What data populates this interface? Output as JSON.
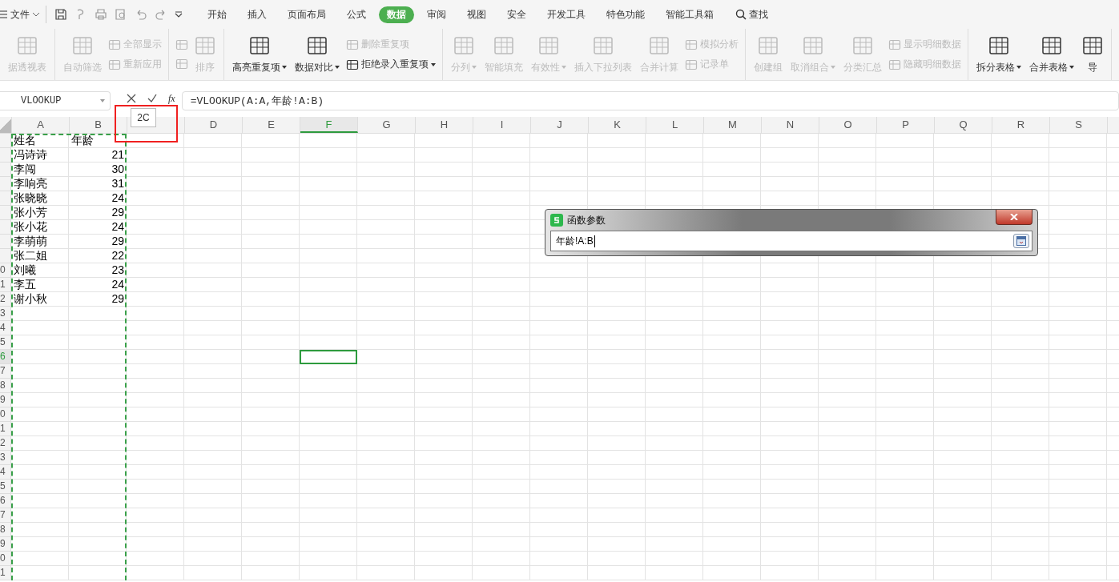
{
  "menu": {
    "label": "文件"
  },
  "tabs": [
    {
      "label": "开始",
      "selected": false
    },
    {
      "label": "插入",
      "selected": false
    },
    {
      "label": "页面布局",
      "selected": false
    },
    {
      "label": "公式",
      "selected": false
    },
    {
      "label": "数据",
      "selected": true
    },
    {
      "label": "审阅",
      "selected": false
    },
    {
      "label": "视图",
      "selected": false
    },
    {
      "label": "安全",
      "selected": false
    },
    {
      "label": "开发工具",
      "selected": false
    },
    {
      "label": "特色功能",
      "selected": false
    },
    {
      "label": "智能工具箱",
      "selected": false
    }
  ],
  "search": {
    "label": "查找"
  },
  "ribbon": {
    "groups": [
      {
        "items": [
          {
            "kind": "large",
            "label": "据透视表",
            "disabled": true,
            "dropdown": false
          }
        ]
      },
      {
        "items": [
          {
            "kind": "large",
            "label": "自动筛选",
            "disabled": true,
            "dropdown": false
          },
          {
            "kind": "stack",
            "children": [
              {
                "label": "全部显示",
                "disabled": true,
                "dropdown": false
              },
              {
                "label": "重新应用",
                "disabled": true,
                "dropdown": false
              }
            ]
          }
        ]
      },
      {
        "items": [
          {
            "kind": "stack",
            "children": [
              {
                "disabled": true,
                "dropdown": false
              },
              {
                "disabled": true,
                "dropdown": false
              }
            ]
          },
          {
            "kind": "large",
            "label": "排序",
            "disabled": true,
            "dropdown": false
          }
        ]
      },
      {
        "items": [
          {
            "kind": "large",
            "label": "高亮重复项",
            "disabled": false,
            "dropdown": true
          },
          {
            "kind": "large",
            "label": "数据对比",
            "disabled": false,
            "dropdown": true
          },
          {
            "kind": "stack",
            "children": [
              {
                "label": "删除重复项",
                "disabled": true,
                "dropdown": false
              },
              {
                "label": "拒绝录入重复项",
                "disabled": false,
                "dropdown": true
              }
            ]
          }
        ]
      },
      {
        "items": [
          {
            "kind": "large",
            "label": "分列",
            "disabled": true,
            "dropdown": true
          },
          {
            "kind": "large",
            "label": "智能填充",
            "disabled": true,
            "dropdown": false
          },
          {
            "kind": "large",
            "label": "有效性",
            "disabled": true,
            "dropdown": true
          },
          {
            "kind": "large",
            "label": "插入下拉列表",
            "disabled": true,
            "dropdown": false
          },
          {
            "kind": "large",
            "label": "合并计算",
            "disabled": true,
            "dropdown": false
          },
          {
            "kind": "stack",
            "children": [
              {
                "label": "模拟分析",
                "disabled": true,
                "dropdown": false
              },
              {
                "label": "记录单",
                "disabled": true,
                "dropdown": false
              }
            ]
          }
        ]
      },
      {
        "items": [
          {
            "kind": "large",
            "label": "创建组",
            "disabled": true,
            "dropdown": false
          },
          {
            "kind": "large",
            "label": "取消组合",
            "disabled": true,
            "dropdown": true
          },
          {
            "kind": "large",
            "label": "分类汇总",
            "disabled": true,
            "dropdown": false
          },
          {
            "kind": "stack",
            "children": [
              {
                "label": "显示明细数据",
                "disabled": true,
                "dropdown": false
              },
              {
                "label": "隐藏明细数据",
                "disabled": true,
                "dropdown": false
              }
            ]
          }
        ]
      },
      {
        "items": [
          {
            "kind": "large",
            "label": "拆分表格",
            "disabled": false,
            "dropdown": true
          },
          {
            "kind": "large",
            "label": "合并表格",
            "disabled": false,
            "dropdown": true
          },
          {
            "kind": "large",
            "label": "导",
            "disabled": false,
            "dropdown": false
          }
        ]
      }
    ]
  },
  "name_box": {
    "value": "VLOOKUP"
  },
  "formula_bar": {
    "function_label": "fx",
    "value": "=VLOOKUP(A:A,年龄!A:B)"
  },
  "tooltip": {
    "label": "2C"
  },
  "columns": [
    {
      "label": "A",
      "selected": false
    },
    {
      "label": "B",
      "selected": false
    },
    {
      "selected": false
    },
    {
      "label": "D",
      "selected": false
    },
    {
      "label": "E",
      "selected": false
    },
    {
      "label": "F",
      "selected": true
    },
    {
      "label": "G",
      "selected": false
    },
    {
      "label": "H",
      "selected": false
    },
    {
      "label": "I",
      "selected": false
    },
    {
      "label": "J",
      "selected": false
    },
    {
      "label": "K",
      "selected": false
    },
    {
      "label": "L",
      "selected": false
    },
    {
      "label": "M",
      "selected": false
    },
    {
      "label": "N",
      "selected": false
    },
    {
      "label": "O",
      "selected": false
    },
    {
      "label": "P",
      "selected": false
    },
    {
      "label": "Q",
      "selected": false
    },
    {
      "label": "R",
      "selected": false
    },
    {
      "label": "S",
      "selected": false
    }
  ],
  "rows": [
    {
      "selected": false,
      "cells": [
        {
          "kind": "text",
          "text": "姓名"
        },
        {
          "kind": "text",
          "text": "年龄"
        }
      ]
    },
    {
      "selected": false,
      "cells": [
        {
          "kind": "text",
          "text": "冯诗诗"
        },
        {
          "kind": "number",
          "text": "21"
        }
      ]
    },
    {
      "selected": false,
      "cells": [
        {
          "kind": "text",
          "text": "李闯"
        },
        {
          "kind": "number",
          "text": "30"
        }
      ]
    },
    {
      "selected": false,
      "cells": [
        {
          "kind": "text",
          "text": "李响亮"
        },
        {
          "kind": "number",
          "text": "31"
        }
      ]
    },
    {
      "selected": false,
      "cells": [
        {
          "kind": "text",
          "text": "张晓晓"
        },
        {
          "kind": "number",
          "text": "24"
        }
      ]
    },
    {
      "selected": false,
      "cells": [
        {
          "kind": "text",
          "text": "张小芳"
        },
        {
          "kind": "number",
          "text": "29"
        }
      ]
    },
    {
      "selected": false,
      "cells": [
        {
          "kind": "text",
          "text": "张小花"
        },
        {
          "kind": "number",
          "text": "24"
        }
      ]
    },
    {
      "selected": false,
      "cells": [
        {
          "kind": "text",
          "text": "李萌萌"
        },
        {
          "kind": "number",
          "text": "29"
        }
      ]
    },
    {
      "selected": false,
      "cells": [
        {
          "kind": "text",
          "text": "张二姐"
        },
        {
          "kind": "number",
          "text": "22"
        }
      ]
    },
    {
      "number": "0",
      "selected": false,
      "cells": [
        {
          "kind": "text",
          "text": "刘曦"
        },
        {
          "kind": "number",
          "text": "23"
        }
      ]
    },
    {
      "number": "1",
      "selected": false,
      "cells": [
        {
          "kind": "text",
          "text": "李五"
        },
        {
          "kind": "number",
          "text": "24"
        }
      ]
    },
    {
      "number": "2",
      "selected": false,
      "cells": [
        {
          "kind": "text",
          "text": "谢小秋"
        },
        {
          "kind": "number",
          "text": "29"
        }
      ]
    },
    {
      "number": "3",
      "selected": false,
      "cells": []
    },
    {
      "number": "4",
      "selected": false,
      "cells": []
    },
    {
      "number": "5",
      "selected": false,
      "cells": []
    },
    {
      "number": "6",
      "selected": true,
      "cells": []
    },
    {
      "number": "7",
      "selected": false,
      "cells": []
    },
    {
      "number": "8",
      "selected": false,
      "cells": []
    },
    {
      "number": "9",
      "selected": false,
      "cells": []
    },
    {
      "number": "0",
      "selected": false,
      "cells": []
    },
    {
      "number": "1",
      "selected": false,
      "cells": []
    },
    {
      "number": "2",
      "selected": false,
      "cells": []
    },
    {
      "number": "3",
      "selected": false,
      "cells": []
    },
    {
      "number": "4",
      "selected": false,
      "cells": []
    },
    {
      "number": "5",
      "selected": false,
      "cells": []
    },
    {
      "number": "6",
      "selected": false,
      "cells": []
    },
    {
      "number": "7",
      "selected": false,
      "cells": []
    },
    {
      "number": "8",
      "selected": false,
      "cells": []
    },
    {
      "number": "9",
      "selected": false,
      "cells": []
    },
    {
      "number": "0",
      "selected": false,
      "cells": []
    },
    {
      "number": "1",
      "selected": false,
      "cells": []
    }
  ],
  "dialog": {
    "title": "函数参数",
    "value": "年龄!A:B"
  }
}
